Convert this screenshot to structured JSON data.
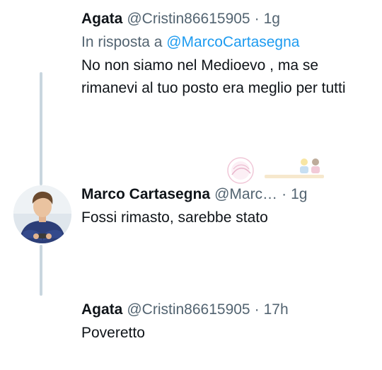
{
  "thread": {
    "tweets": [
      {
        "name": "Agata",
        "handle": "@Cristin86615905",
        "time": "1g",
        "reply_prefix": "In risposta a ",
        "reply_to": "@MarcoCartasegna",
        "text": "No non siamo nel Medioevo , ma se rimanevi al tuo posto era meglio per tutti"
      },
      {
        "name": "Marco Cartasegna",
        "handle": "@Marc…",
        "time": "1g",
        "text": "Fossi rimasto, sarebbe stato"
      },
      {
        "name": "Agata",
        "handle": "@Cristin86615905",
        "time": "17h",
        "text": "Poveretto"
      }
    ],
    "separator": "·"
  },
  "colors": {
    "name": "#0f1419",
    "secondary": "#536471",
    "mention": "#1d9bf0",
    "thread_line": "#c9d6df"
  }
}
